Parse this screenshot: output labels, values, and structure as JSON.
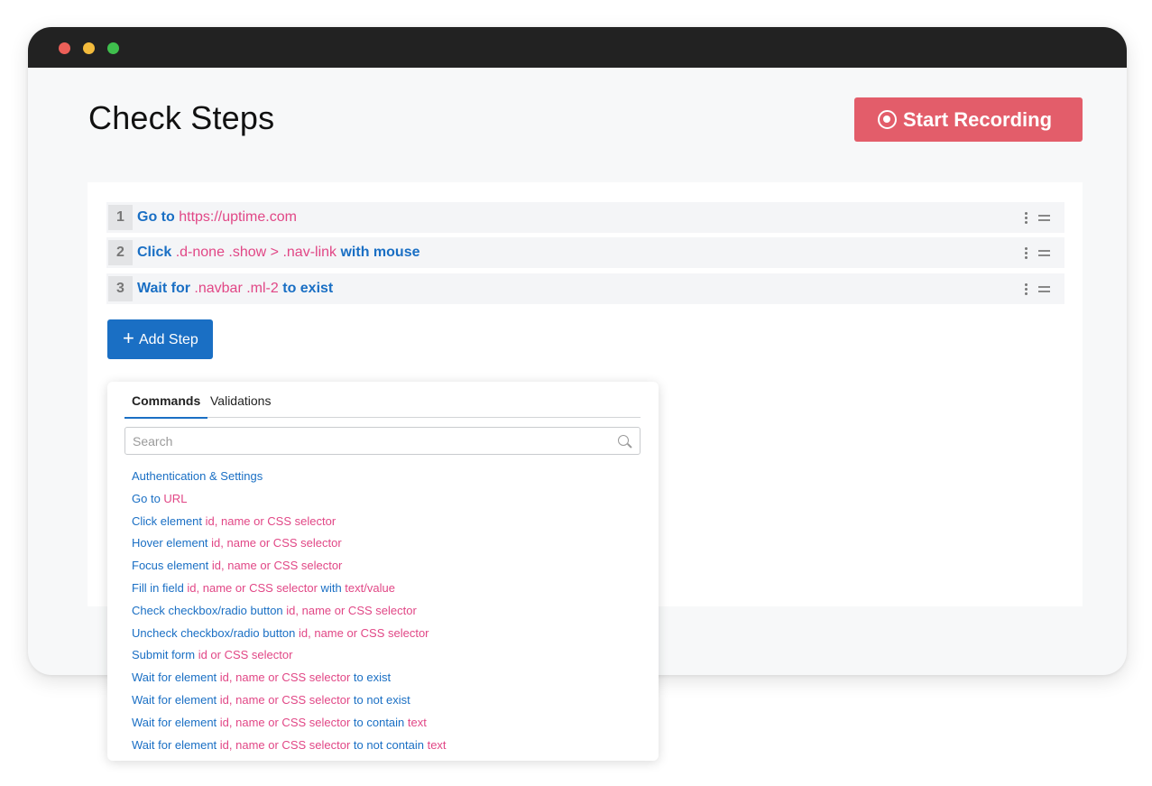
{
  "window": {
    "controls": [
      "close-dot",
      "minimize-dot",
      "maximize-dot"
    ]
  },
  "header": {
    "title": "Check Steps",
    "record_label": "Start Recording"
  },
  "steps": [
    {
      "number": "1",
      "keyword": "Go to",
      "target": "https://uptime.com",
      "suffix": ""
    },
    {
      "number": "2",
      "keyword": "Click",
      "target": ".d-none .show > .nav-link",
      "suffix": "with mouse"
    },
    {
      "number": "3",
      "keyword": "Wait for",
      "target": ".navbar .ml-2",
      "suffix": "to exist"
    }
  ],
  "add_step_label": "Add Step",
  "dropdown": {
    "tabs": [
      "Commands",
      "Validations"
    ],
    "active_tab": "Commands",
    "search_placeholder": "Search",
    "commands": [
      [
        {
          "t": "Authentication & Settings",
          "v": false
        }
      ],
      [
        {
          "t": "Go to ",
          "v": false
        },
        {
          "t": "URL",
          "v": true
        }
      ],
      [
        {
          "t": "Click element ",
          "v": false
        },
        {
          "t": "id, name or CSS selector",
          "v": true
        }
      ],
      [
        {
          "t": "Hover element ",
          "v": false
        },
        {
          "t": "id, name or CSS selector",
          "v": true
        }
      ],
      [
        {
          "t": "Focus element ",
          "v": false
        },
        {
          "t": "id, name or CSS selector",
          "v": true
        }
      ],
      [
        {
          "t": "Fill in field ",
          "v": false
        },
        {
          "t": "id, name or CSS selector",
          "v": true
        },
        {
          "t": " with ",
          "v": false
        },
        {
          "t": "text/value",
          "v": true
        }
      ],
      [
        {
          "t": "Check checkbox/radio button ",
          "v": false
        },
        {
          "t": "id, name or CSS selector",
          "v": true
        }
      ],
      [
        {
          "t": "Uncheck checkbox/radio button ",
          "v": false
        },
        {
          "t": "id, name or CSS selector",
          "v": true
        }
      ],
      [
        {
          "t": "Submit form ",
          "v": false
        },
        {
          "t": "id or CSS selector",
          "v": true
        }
      ],
      [
        {
          "t": "Wait for element ",
          "v": false
        },
        {
          "t": "id, name or CSS selector",
          "v": true
        },
        {
          "t": " to exist",
          "v": false
        }
      ],
      [
        {
          "t": "Wait for element ",
          "v": false
        },
        {
          "t": "id, name or CSS selector",
          "v": true
        },
        {
          "t": " to not exist",
          "v": false
        }
      ],
      [
        {
          "t": "Wait for element ",
          "v": false
        },
        {
          "t": "id, name or CSS selector",
          "v": true
        },
        {
          "t": " to contain ",
          "v": false
        },
        {
          "t": "text",
          "v": true
        }
      ],
      [
        {
          "t": "Wait for element ",
          "v": false
        },
        {
          "t": "id, name or CSS selector",
          "v": true
        },
        {
          "t": " to not contain ",
          "v": false
        },
        {
          "t": "text",
          "v": true
        }
      ]
    ]
  },
  "colors": {
    "accent_blue": "#1a6fc4",
    "value_pink": "#e14786",
    "record_red": "#e35d6a"
  }
}
